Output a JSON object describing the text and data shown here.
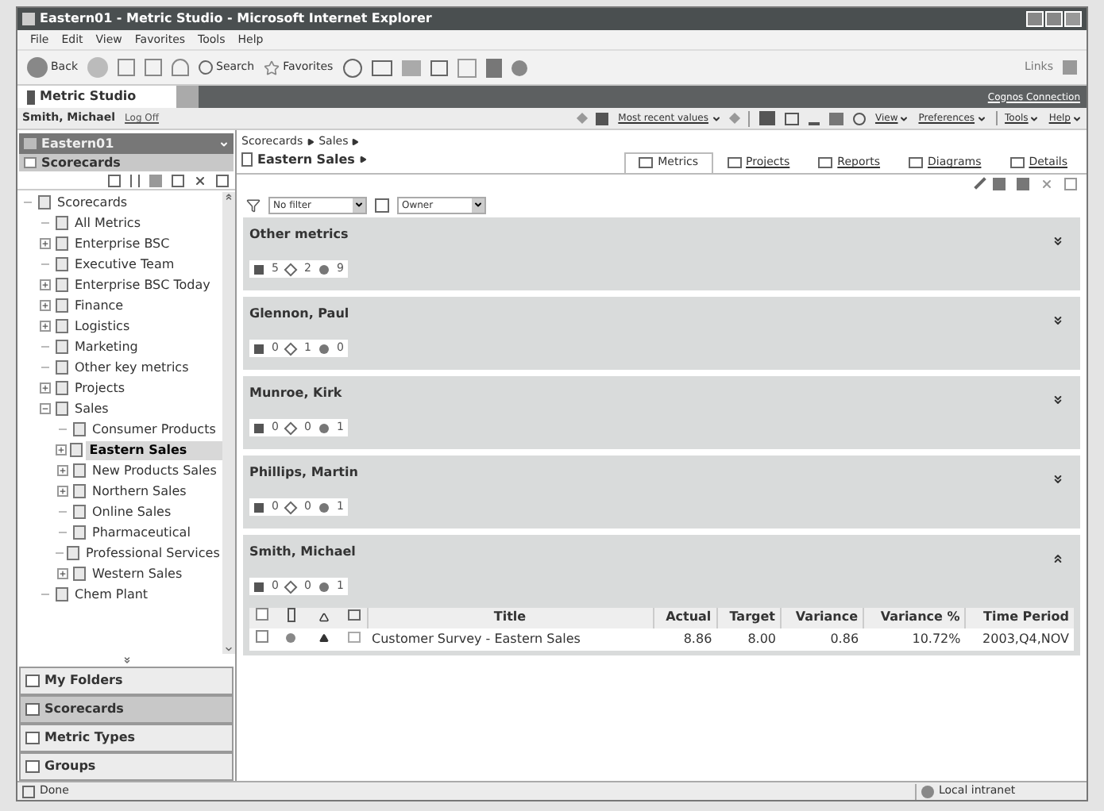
{
  "window": {
    "title": "Eastern01 - Metric Studio - Microsoft Internet Explorer"
  },
  "menu": [
    "File",
    "Edit",
    "View",
    "Favorites",
    "Tools",
    "Help"
  ],
  "toolbar": {
    "back": "Back",
    "search": "Search",
    "favorites": "Favorites",
    "links": "Links"
  },
  "app_bar": {
    "tab": "Metric Studio",
    "link": "Cognos Connection"
  },
  "user_bar": {
    "user": "Smith, Michael",
    "logoff": "Log Off",
    "values": "Most recent values",
    "menus": [
      "View",
      "Preferences",
      "Tools",
      "Help"
    ]
  },
  "sidebar": {
    "header": "Eastern01",
    "section": "Scorecards",
    "tree": [
      {
        "label": "Scorecards",
        "kind": "leaf",
        "selected": false,
        "children": [
          {
            "label": "All Metrics",
            "kind": "leaf",
            "selected": false
          },
          {
            "label": "Enterprise BSC",
            "kind": "closed",
            "selected": false
          },
          {
            "label": "Executive Team",
            "kind": "leaf",
            "selected": false
          },
          {
            "label": "Enterprise BSC Today",
            "kind": "closed",
            "selected": false
          },
          {
            "label": "Finance",
            "kind": "closed",
            "selected": false
          },
          {
            "label": "Logistics",
            "kind": "closed",
            "selected": false
          },
          {
            "label": "Marketing",
            "kind": "leaf",
            "selected": false
          },
          {
            "label": "Other key metrics",
            "kind": "leaf",
            "selected": false
          },
          {
            "label": "Projects",
            "kind": "closed",
            "selected": false
          },
          {
            "label": "Sales",
            "kind": "open",
            "selected": false,
            "children": [
              {
                "label": "Consumer Products",
                "kind": "leaf",
                "selected": false
              },
              {
                "label": "Eastern Sales",
                "kind": "closed",
                "selected": true
              },
              {
                "label": "New Products Sales",
                "kind": "closed",
                "selected": false
              },
              {
                "label": "Northern Sales",
                "kind": "closed",
                "selected": false
              },
              {
                "label": "Online Sales",
                "kind": "leaf",
                "selected": false
              },
              {
                "label": "Pharmaceutical",
                "kind": "leaf",
                "selected": false
              },
              {
                "label": "Professional Services",
                "kind": "leaf",
                "selected": false
              },
              {
                "label": "Western Sales",
                "kind": "closed",
                "selected": false
              }
            ]
          },
          {
            "label": "Chem Plant",
            "kind": "leaf",
            "selected": false
          }
        ]
      }
    ],
    "accordion": [
      {
        "label": "My Folders",
        "selected": false
      },
      {
        "label": "Scorecards",
        "selected": true
      },
      {
        "label": "Metric Types",
        "selected": false
      },
      {
        "label": "Groups",
        "selected": false
      }
    ]
  },
  "breadcrumb": {
    "path": [
      "Scorecards",
      "Sales"
    ],
    "current": "Eastern Sales"
  },
  "tabs": [
    {
      "label": "Metrics",
      "selected": true
    },
    {
      "label": "Projects",
      "selected": false
    },
    {
      "label": "Reports",
      "selected": false
    },
    {
      "label": "Diagrams",
      "selected": false
    },
    {
      "label": "Details",
      "selected": false
    }
  ],
  "filters": [
    {
      "value": "No filter"
    },
    {
      "value": "Owner"
    }
  ],
  "groups": [
    {
      "name": "Other metrics",
      "counts": [
        "5",
        "2",
        "9"
      ],
      "expanded": false
    },
    {
      "name": "Glennon, Paul",
      "counts": [
        "0",
        "1",
        "0"
      ],
      "expanded": false
    },
    {
      "name": "Munroe, Kirk",
      "counts": [
        "0",
        "0",
        "1"
      ],
      "expanded": false
    },
    {
      "name": "Phillips, Martin",
      "counts": [
        "0",
        "0",
        "1"
      ],
      "expanded": false
    },
    {
      "name": "Smith, Michael",
      "counts": [
        "0",
        "0",
        "1"
      ],
      "expanded": true
    }
  ],
  "table": {
    "all_checked": false,
    "columns": [
      "Title",
      "Actual",
      "Target",
      "Variance",
      "Variance %",
      "Time Period"
    ],
    "rows": [
      {
        "cells": [
          "Customer Survey - Eastern Sales",
          "8.86",
          "8.00",
          "0.86",
          "10.72%",
          "2003,Q4,NOV"
        ],
        "checked": false
      }
    ]
  },
  "status_bar": {
    "left": "Done",
    "right": "Local intranet"
  }
}
